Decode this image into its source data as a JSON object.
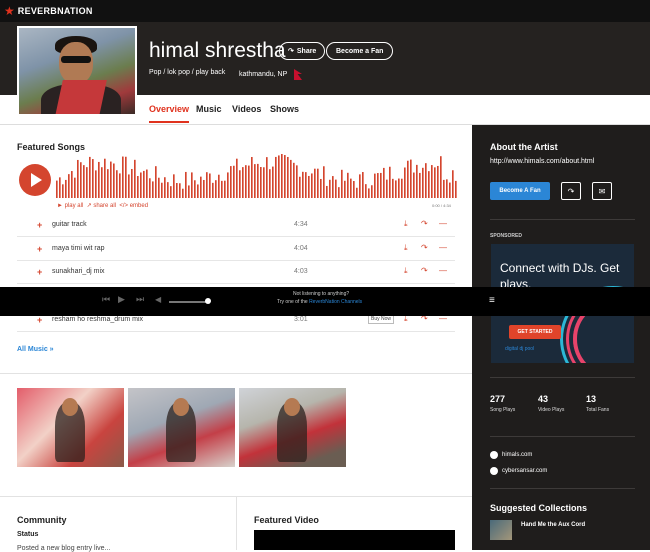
{
  "brand": {
    "logo": "REVERBNATION"
  },
  "artist": {
    "name": "himal shrestha",
    "genre": "Pop / lok pop / play back",
    "location": "kathmandu, NP"
  },
  "header_buttons": {
    "share": "Share",
    "become_fan": "Become a Fan"
  },
  "tabs": [
    {
      "label": "Overview",
      "active": true
    },
    {
      "label": "Music"
    },
    {
      "label": "Videos"
    },
    {
      "label": "Shows"
    }
  ],
  "featured_songs": {
    "title": "Featured Songs",
    "links": {
      "play_all": "► play all",
      "share_all": "↗ share all",
      "embed": "</> embed"
    },
    "time": "0:00 / 4:34",
    "songs": [
      {
        "title": "guitar track",
        "duration": "4:34"
      },
      {
        "title": "maya timi wit rap",
        "duration": "4:04"
      },
      {
        "title": "sunakhari_dj mix",
        "duration": "4:03"
      },
      {
        "title": "resham ho reshma_drum mix",
        "duration": "3:01",
        "buy": "Buy Now"
      }
    ],
    "all_music": "All Music »"
  },
  "community": {
    "title": "Community",
    "status_label": "Status",
    "status_text": "Posted a new blog entry live..."
  },
  "featured_video": {
    "title": "Featured Video"
  },
  "sidebar": {
    "about_title": "About the Artist",
    "url": "http://www.himals.com/about.html",
    "become_fan": "Become A Fan",
    "sponsored": "SPONSORED",
    "ad": {
      "headline": "Connect with DJs. Get plays.",
      "cta": "GET STARTED",
      "brand": "digital dj pool"
    },
    "stats": [
      {
        "value": "277",
        "label": "Song Plays"
      },
      {
        "value": "43",
        "label": "Video Plays"
      },
      {
        "value": "13",
        "label": "Total Fans"
      }
    ],
    "links": [
      "himals.com",
      "cybersansar.com"
    ],
    "collections_title": "Suggested Collections",
    "collection": "Hand Me the Aux Cord"
  },
  "player": {
    "not_listening": "Not listening to anything?",
    "try_prefix": "Try one of the",
    "try_link": "ReverbNation Channels"
  },
  "colors": {
    "accent": "#d4452e",
    "link": "#2b86d6",
    "sidebar": "#1f1d1c",
    "header": "#252220"
  }
}
